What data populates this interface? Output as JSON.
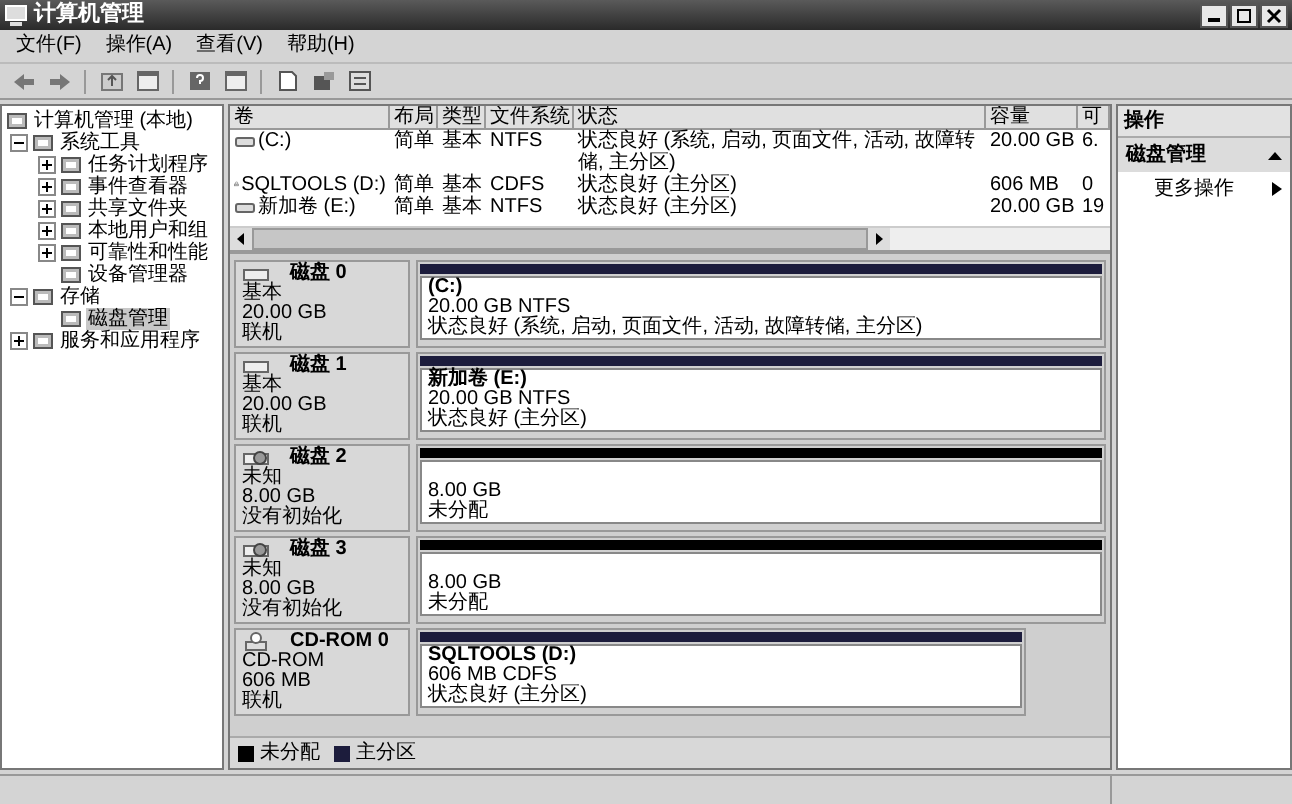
{
  "window": {
    "title": "计算机管理"
  },
  "menu": [
    "文件(F)",
    "操作(A)",
    "查看(V)",
    "帮助(H)"
  ],
  "tree": [
    {
      "label": "计算机管理 (本地)",
      "selected": false,
      "children": [
        {
          "label": "系统工具",
          "expanded": true,
          "selected": false,
          "children": [
            {
              "label": "任务计划程序",
              "expanded": false,
              "selected": false
            },
            {
              "label": "事件查看器",
              "expanded": false,
              "selected": false
            },
            {
              "label": "共享文件夹",
              "expanded": false,
              "selected": false
            },
            {
              "label": "本地用户和组",
              "expanded": false,
              "selected": false
            },
            {
              "label": "可靠性和性能",
              "expanded": false,
              "selected": false
            },
            {
              "label": "设备管理器",
              "selected": false
            }
          ]
        },
        {
          "label": "存储",
          "expanded": true,
          "selected": false,
          "children": [
            {
              "label": "磁盘管理",
              "selected": true
            }
          ]
        },
        {
          "label": "服务和应用程序",
          "expanded": false,
          "selected": false
        }
      ]
    }
  ],
  "volumes": {
    "columns": [
      "卷",
      "布局",
      "类型",
      "文件系统",
      "状态",
      "容量",
      "可"
    ],
    "rows": [
      {
        "kind": "disk",
        "cells": [
          "(C:)",
          "简单",
          "基本",
          "NTFS",
          "状态良好 (系统, 启动, 页面文件, 活动, 故障转储, 主分区)",
          "20.00 GB",
          "6."
        ]
      },
      {
        "kind": "cdrom",
        "cells": [
          "SQLTOOLS (D:)",
          "简单",
          "基本",
          "CDFS",
          "状态良好 (主分区)",
          "606 MB",
          "0"
        ]
      },
      {
        "kind": "disk",
        "cells": [
          "新加卷 (E:)",
          "简单",
          "基本",
          "NTFS",
          "状态良好 (主分区)",
          "20.00 GB",
          "19"
        ]
      }
    ]
  },
  "disks": [
    {
      "name": "磁盘 0",
      "kind": "basic",
      "type": "基本",
      "size": "20.00 GB",
      "status": "联机",
      "partitions": [
        {
          "kind": "primary",
          "label": "(C:)",
          "detail": "20.00 GB NTFS",
          "status": "状态良好 (系统, 启动, 页面文件, 活动, 故障转储, 主分区)"
        }
      ]
    },
    {
      "name": "磁盘 1",
      "kind": "basic",
      "type": "基本",
      "size": "20.00 GB",
      "status": "联机",
      "partitions": [
        {
          "kind": "primary",
          "label": "新加卷 (E:)",
          "detail": "20.00 GB NTFS",
          "status": "状态良好 (主分区)"
        }
      ]
    },
    {
      "name": "磁盘 2",
      "kind": "unknown",
      "type": "未知",
      "size": "8.00 GB",
      "status": "没有初始化",
      "partitions": [
        {
          "kind": "unallocated",
          "detail": "8.00 GB",
          "status": "未分配"
        }
      ]
    },
    {
      "name": "磁盘 3",
      "kind": "unknown",
      "type": "未知",
      "size": "8.00 GB",
      "status": "没有初始化",
      "partitions": [
        {
          "kind": "unallocated",
          "detail": "8.00 GB",
          "status": "未分配"
        }
      ]
    },
    {
      "name": "CD-ROM 0",
      "kind": "cdrom",
      "type": "CD-ROM",
      "size": "606 MB",
      "status": "联机",
      "partitions": [
        {
          "kind": "primary",
          "label": "SQLTOOLS (D:)",
          "detail": "606 MB CDFS",
          "status": "状态良好 (主分区)"
        }
      ]
    }
  ],
  "legend": [
    {
      "kind": "unallocated",
      "label": "未分配",
      "color": "#000000"
    },
    {
      "kind": "primary",
      "label": "主分区",
      "color": "#1c1c3c"
    }
  ],
  "actions": {
    "title": "操作",
    "section": {
      "label": "磁盘管理",
      "expanded": true
    },
    "items": [
      "更多操作"
    ]
  }
}
